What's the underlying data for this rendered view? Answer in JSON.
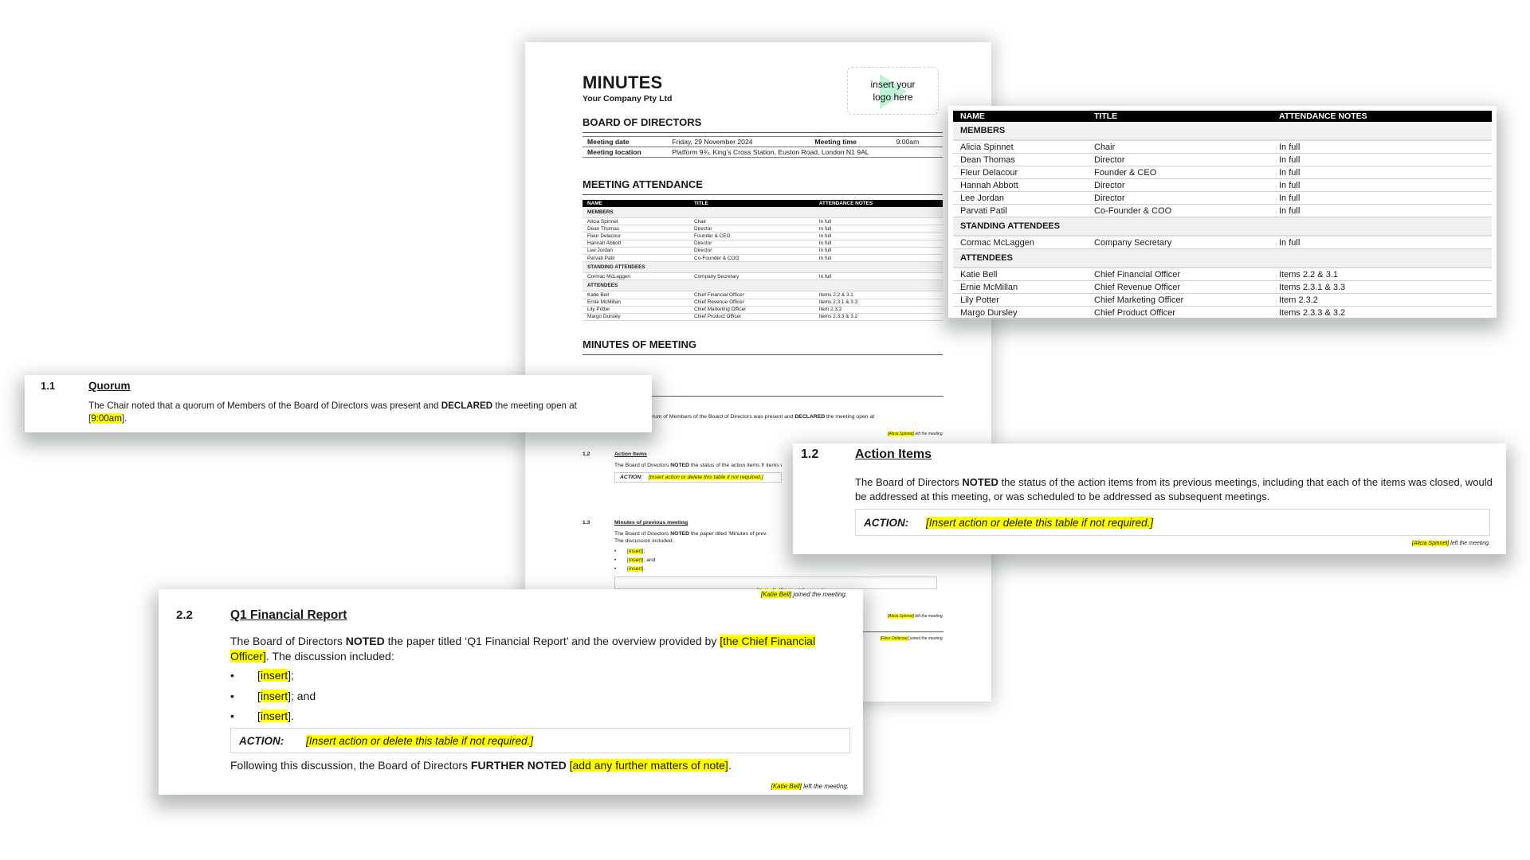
{
  "document": {
    "title": "MINUTES",
    "company": "Your Company Pty Ltd",
    "logo_placeholder": [
      "insert your",
      "logo here"
    ],
    "board_heading": "BOARD OF DIRECTORS",
    "meeting_details": {
      "date_label": "Meeting date",
      "date_value": "Friday, 29 November 2024",
      "time_label": "Meeting time",
      "time_value": "9:00am",
      "location_label": "Meeting location",
      "location_value": "Platform 9¾, King's Cross Station, Euston Road, London N1 9AL"
    },
    "attendance_heading": "MEETING ATTENDANCE",
    "minutes_heading": "MINUTES OF MEETING"
  },
  "attendance": {
    "columns": [
      "NAME",
      "TITLE",
      "ATTENDANCE NOTES"
    ],
    "groups": [
      {
        "label": "MEMBERS",
        "rows": [
          [
            "Alicia Spinnet",
            "Chair",
            "In full"
          ],
          [
            "Dean Thomas",
            "Director",
            "In full"
          ],
          [
            "Fleur Delacour",
            "Founder & CEO",
            "In full"
          ],
          [
            "Hannah Abbott",
            "Director",
            "In full"
          ],
          [
            "Lee Jordan",
            "Director",
            "In full"
          ],
          [
            "Parvati Patil",
            "Co-Founder & COO",
            "In full"
          ]
        ]
      },
      {
        "label": "STANDING ATTENDEES",
        "rows": [
          [
            "Cormac McLaggen",
            "Company Secretary",
            "In full"
          ]
        ]
      },
      {
        "label": "ATTENDEES",
        "rows": [
          [
            "Katie Bell",
            "Chief Financial Officer",
            "Items 2.2 & 3.1"
          ],
          [
            "Ernie McMillan",
            "Chief Revenue Officer",
            "Items 2.3.1 & 3.3"
          ],
          [
            "Lily Potter",
            "Chief Marketing Officer",
            "Item 2.3.2"
          ],
          [
            "Margo Dursley",
            "Chief Product Officer",
            "Items 2.3.3 & 3.2"
          ]
        ]
      }
    ]
  },
  "quorum": {
    "number": "1.1",
    "heading": "Quorum",
    "text_before": "The Chair noted that a quorum of Members of the Board of Directors was present and ",
    "text_bold": "DECLARED",
    "text_after": " the meeting open at",
    "open_bracket": "[",
    "time_highlight": "9:00am",
    "close": "].",
    "partial_text": "ed that a quorum of Members of the Board of Directors was present and ",
    "partial_bold": "DECLARED",
    "partial_after": " the meeting open at"
  },
  "action_items": {
    "number": "1.2",
    "heading": "Action Items",
    "text_before": "The Board of Directors ",
    "text_bold": "NOTED",
    "text_after": " the status of the action items from its previous meetings, including that each of the items was closed, would be addressed at this meeting, or was scheduled to be addressed as subsequent meetings.",
    "small_text_after": " the status of the action items fr items was closed, would be addressed at this meeting, or was",
    "action_label": "ACTION:",
    "action_text": "[Insert action or delete this table if not required.]",
    "leave_name": "[Alicia Spinnet]",
    "leave_text": " left the meeting."
  },
  "previous_minutes": {
    "number": "1.3",
    "heading": "Minutes of previous meeting",
    "text_before": "The Board of Directors ",
    "text_bold": "NOTED",
    "text_after": " the paper titled 'Minutes of prev",
    "text_line2": "The discussion included:",
    "bullets": [
      {
        "hl": "insert",
        "suffix": "];"
      },
      {
        "hl": "insert",
        "suffix": "]; and"
      },
      {
        "hl": "insert",
        "suffix": "]."
      }
    ],
    "join_name": "[Katie Bell]",
    "join_text": " joined the meeting."
  },
  "misc_notes": {
    "left_name": "[Alicia Spinnet]",
    "left_text": " left the meeting.",
    "join_name": "[Fleur Delacour]",
    "join_text": " joined the meeting."
  },
  "q1_report": {
    "number": "2.2",
    "heading": "Q1 Financial Report",
    "text_before": "The Board of Directors ",
    "text_bold": "NOTED",
    "text_mid": " the paper titled ‘Q1 Financial Report’ and the overview provided by ",
    "hl_1": "[the Chief Financial",
    "hl_2": "Officer]",
    "text_after": ". The discussion included:",
    "bullets": [
      {
        "hl": "insert",
        "suffix": "];"
      },
      {
        "hl": "insert",
        "suffix": "]; and"
      },
      {
        "hl": "insert",
        "suffix": "]."
      }
    ],
    "action_label": "ACTION:",
    "action_text": "[Insert action or delete this table if not required.]",
    "further_before": "Following this discussion, the Board of Directors ",
    "further_bold": "FURTHER NOTED",
    "further_hl": "[add any further matters of note]",
    "further_end": ".",
    "leave_name": "[Katie Bell]",
    "leave_text": " left the meeting."
  },
  "colors": {
    "highlight": "#ffff00",
    "table_header_bg": "#000000",
    "group_row_bg": "#f0f0f0",
    "logo_accent": "#bff3d6"
  }
}
